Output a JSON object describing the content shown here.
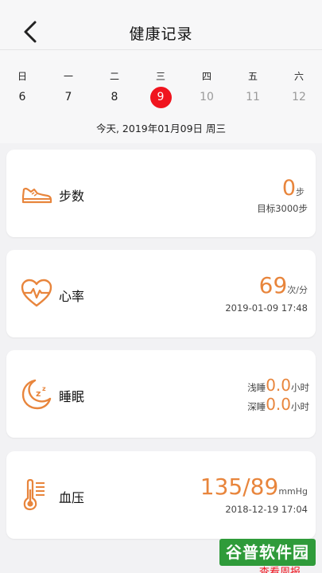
{
  "header": {
    "title": "健康记录",
    "back_icon": "chevron-left-icon"
  },
  "calendar": {
    "weekdays": [
      "日",
      "一",
      "二",
      "三",
      "四",
      "五",
      "六"
    ],
    "days": [
      "6",
      "7",
      "8",
      "9",
      "10",
      "11",
      "12"
    ],
    "selected_day": "9",
    "date_line": "今天, 2019年01月09日 周三",
    "selected_color": "#f0141e"
  },
  "cards": {
    "steps": {
      "label": "步数",
      "value": "0",
      "unit": "步",
      "goal": "目标3000步",
      "icon": "shoe-icon"
    },
    "heart_rate": {
      "label": "心率",
      "value": "69",
      "unit": "次/分",
      "time": "2019-01-09 17:48",
      "icon": "heart-pulse-icon"
    },
    "sleep": {
      "label": "睡眠",
      "light_label": "浅睡",
      "light_value": "0.0",
      "light_unit": "小时",
      "deep_label": "深睡",
      "deep_value": "0.0",
      "deep_unit": "小时",
      "icon": "moon-sleep-icon"
    },
    "blood_pressure": {
      "label": "血压",
      "value": "135/89",
      "unit": "mmHg",
      "time": "2018-12-19 17:04",
      "icon": "thermometer-icon"
    }
  },
  "footer": {
    "more_link": "查看周报"
  },
  "watermark": {
    "text": "谷普软件园"
  },
  "colors": {
    "accent": "#e8853c",
    "selected": "#f0141e",
    "background": "#f2f2f4"
  }
}
